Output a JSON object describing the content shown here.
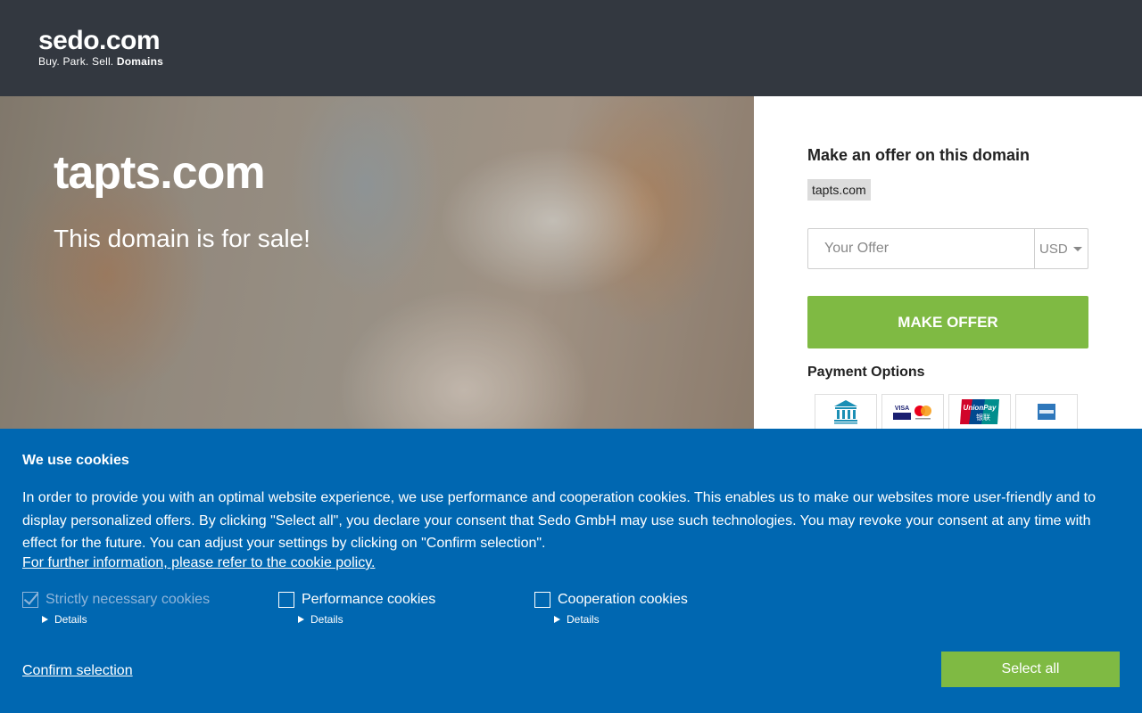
{
  "header": {
    "logo_main": "sedo.com",
    "logo_tagline": "Buy.  Park.  Sell.",
    "logo_tagline_bold": "Domains"
  },
  "hero": {
    "domain": "tapts.com",
    "subtitle": "This domain is for sale!"
  },
  "offer": {
    "title": "Make an offer on this domain",
    "domain_tag": "tapts.com",
    "input_placeholder": "Your Offer",
    "currency": "USD",
    "button_label": "MAKE OFFER",
    "payment_title": "Payment Options",
    "payment_methods": [
      "bank-transfer-icon",
      "visa-mastercard-icon",
      "unionpay-icon",
      "amex-icon"
    ]
  },
  "cookie": {
    "title": "We use cookies",
    "text": "In order to provide you with an optimal website experience, we use performance and cooperation cookies. This enables us to make our websites more user-friendly and to display personalized offers. By clicking \"Select all\", you declare your consent that Sedo GmbH may use such technologies. You may revoke your consent at any time with effect for the future. You can adjust your settings by clicking on \"Confirm selection\".",
    "policy_link": "For further information, please refer to the cookie policy.",
    "options": [
      {
        "label": "Strictly necessary cookies",
        "details": "Details",
        "checked": true,
        "disabled": true
      },
      {
        "label": "Performance cookies",
        "details": "Details",
        "checked": false,
        "disabled": false
      },
      {
        "label": "Cooperation cookies",
        "details": "Details",
        "checked": false,
        "disabled": false
      }
    ],
    "confirm_label": "Confirm selection",
    "select_all_label": "Select all"
  },
  "colors": {
    "header_bg": "#333840",
    "cookie_bg": "#0067b1",
    "accent_green": "#7fba43"
  }
}
